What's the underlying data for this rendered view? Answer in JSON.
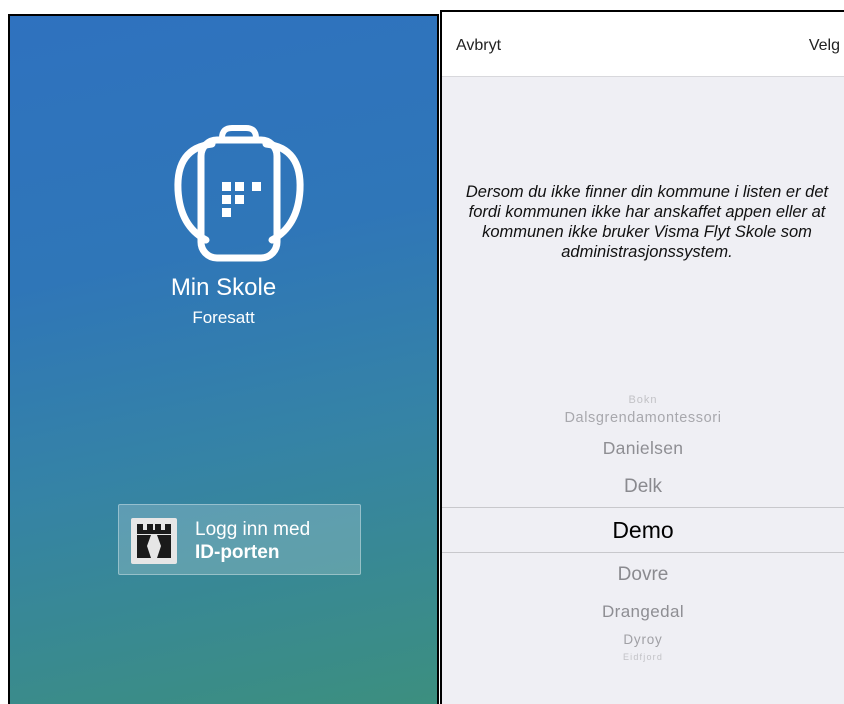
{
  "left_screen": {
    "app_name": "Min Skole",
    "app_subtitle": "Foresatt",
    "login_button": {
      "line1": "Logg inn med",
      "line2": "ID-porten",
      "icon": "id-porten-icon"
    },
    "logo_icon": "backpack-icon",
    "colors": {
      "gradient_top": "#2f72bf",
      "gradient_bottom": "#3c8f7f"
    }
  },
  "right_screen": {
    "nav": {
      "cancel_label": "Avbryt",
      "choose_label": "Velg"
    },
    "info_text": "Dersom du ikke finner din kommune i listen er det fordi kommunen ikke har anskaffet appen eller at kommunen ikke bruker Visma Flyt Skole som administrasjonssystem.",
    "picker": {
      "items": [
        "Bokn",
        "Dalsgrendamontessori",
        "Danielsen",
        "Delk",
        "Demo",
        "Dovre",
        "Drangedal",
        "Dyroy",
        "Eidfjord"
      ],
      "selected": "Demo"
    },
    "colors": {
      "background": "#efeff4",
      "nav_background": "#ffffff"
    }
  }
}
